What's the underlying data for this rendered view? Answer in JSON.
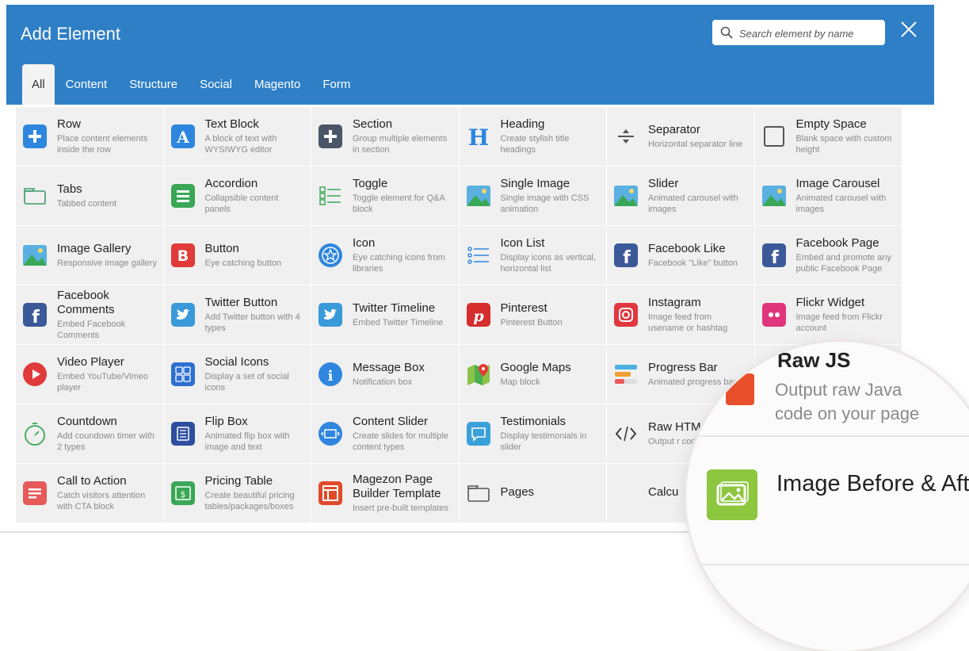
{
  "modal": {
    "title": "Add Element",
    "search": {
      "placeholder": "Search element by name"
    },
    "tabs": [
      {
        "label": "All",
        "active": true
      },
      {
        "label": "Content",
        "active": false
      },
      {
        "label": "Structure",
        "active": false
      },
      {
        "label": "Social",
        "active": false
      },
      {
        "label": "Magento",
        "active": false
      },
      {
        "label": "Form",
        "active": false
      }
    ]
  },
  "colors": {
    "header": "#2e7fc6",
    "cell_bg": "#f0f0f0"
  },
  "elements": [
    {
      "name": "Row",
      "desc": "Place content elements inside the row",
      "icon": "plus-icon",
      "color": "#2e86de"
    },
    {
      "name": "Text Block",
      "desc": "A block of text with WYSIWYG editor",
      "icon": "text-block-icon",
      "color": "#2e86de"
    },
    {
      "name": "Section",
      "desc": "Group multiple elements in section",
      "icon": "plus-icon",
      "color": "#4a5568"
    },
    {
      "name": "Heading",
      "desc": "Create stylish title headings",
      "icon": "heading-icon",
      "color": "#2e86de"
    },
    {
      "name": "Separator",
      "desc": "Horizontal separator line",
      "icon": "separator-icon",
      "color": "#555555"
    },
    {
      "name": "Empty Space",
      "desc": "Blank space with custom height",
      "icon": "empty-space-icon",
      "color": "#555555"
    },
    {
      "name": "Tabs",
      "desc": "Tabbed content",
      "icon": "tabs-icon",
      "color": "#3a9a6a"
    },
    {
      "name": "Accordion",
      "desc": "Collapsible content panels",
      "icon": "accordion-icon",
      "color": "#3aa757"
    },
    {
      "name": "Toggle",
      "desc": "Toggle element for Q&A block",
      "icon": "toggle-icon",
      "color": "#3aa757"
    },
    {
      "name": "Single Image",
      "desc": "Single image with CSS animation",
      "icon": "image-icon",
      "color": "#4ab0e0"
    },
    {
      "name": "Slider",
      "desc": "Animated carousel with images",
      "icon": "slider-icon",
      "color": "#4ab0e0"
    },
    {
      "name": "Image Carousel",
      "desc": "Animated carousel with images",
      "icon": "carousel-icon",
      "color": "#4ab0e0"
    },
    {
      "name": "Image Gallery",
      "desc": "Responsive image gallery",
      "icon": "gallery-icon",
      "color": "#4ab0e0"
    },
    {
      "name": "Button",
      "desc": "Eye catching button",
      "icon": "button-icon",
      "color": "#e03a3a"
    },
    {
      "name": "Icon",
      "desc": "Eye catching icons from libraries",
      "icon": "star-icon",
      "color": "#2e86de"
    },
    {
      "name": "Icon List",
      "desc": "Display icons as vertical, horizontal list",
      "icon": "icon-list-icon",
      "color": "#2e86de"
    },
    {
      "name": "Facebook Like",
      "desc": "Facebook \"Like\" button",
      "icon": "facebook-icon",
      "color": "#3b5998"
    },
    {
      "name": "Facebook Page",
      "desc": "Embed and promote any public Facebook Page",
      "icon": "facebook-icon",
      "color": "#3b5998"
    },
    {
      "name": "Facebook Comments",
      "desc": "Embed Facebook Comments",
      "icon": "facebook-icon",
      "color": "#3b5998"
    },
    {
      "name": "Twitter Button",
      "desc": "Add Twitter button with 4 types",
      "icon": "twitter-icon",
      "color": "#3a9ad9"
    },
    {
      "name": "Twitter Timeline",
      "desc": "Embed Twitter Timeline",
      "icon": "twitter-icon",
      "color": "#3a9ad9"
    },
    {
      "name": "Pinterest",
      "desc": "Pinterest Button",
      "icon": "pinterest-icon",
      "color": "#d62d2d"
    },
    {
      "name": "Instagram",
      "desc": "Image feed from usename or hashtag",
      "icon": "instagram-icon",
      "color": "#e0383e"
    },
    {
      "name": "Flickr Widget",
      "desc": "Image feed from Flickr account",
      "icon": "flickr-icon",
      "color": "#e0357a"
    },
    {
      "name": "Video Player",
      "desc": "Embed YouTube/Vimeo player",
      "icon": "play-icon",
      "color": "#e03a3a"
    },
    {
      "name": "Social Icons",
      "desc": "Display a set of social icons",
      "icon": "social-icons-icon",
      "color": "#2e6fd0"
    },
    {
      "name": "Message Box",
      "desc": "Notification box",
      "icon": "info-icon",
      "color": "#2e86de"
    },
    {
      "name": "Google Maps",
      "desc": "Map block",
      "icon": "map-icon",
      "color": "#34a853"
    },
    {
      "name": "Progress Bar",
      "desc": "Animated progress bar",
      "icon": "progress-icon",
      "color": "#f0a030"
    },
    {
      "name": "",
      "desc": "",
      "icon": "",
      "color": "#f0f0f0"
    },
    {
      "name": "Countdown",
      "desc": "Add coundown timer with 2 types",
      "icon": "timer-icon",
      "color": "#3aa757"
    },
    {
      "name": "Flip Box",
      "desc": "Animated flip box with image and text",
      "icon": "flip-box-icon",
      "color": "#2e4fa0"
    },
    {
      "name": "Content Slider",
      "desc": "Create slides for multiple content types",
      "icon": "content-slider-icon",
      "color": "#2e86de"
    },
    {
      "name": "Testimonials",
      "desc": "Display testimonials in slider",
      "icon": "chat-icon",
      "color": "#3aa0d9"
    },
    {
      "name": "Raw HTM",
      "desc": "Output r code on",
      "icon": "code-icon",
      "color": "#333333"
    },
    {
      "name": "",
      "desc": "",
      "icon": "",
      "color": "#f0f0f0"
    },
    {
      "name": "Call to Action",
      "desc": "Catch visitors attention with CTA block",
      "icon": "cta-icon",
      "color": "#e85a5a"
    },
    {
      "name": "Pricing Table",
      "desc": "Create beautiful pricing tables/packages/boxes",
      "icon": "pricing-icon",
      "color": "#3aa757"
    },
    {
      "name": "Magezon Page Builder Template",
      "desc": "Insert pre-built templates",
      "icon": "template-icon",
      "color": "#e04a2a"
    },
    {
      "name": "Pages",
      "desc": "",
      "icon": "pages-icon",
      "color": "#2e86de"
    },
    {
      "name": "Calcu",
      "desc": "",
      "icon": "",
      "color": "#f0f0f0"
    },
    {
      "name": "",
      "desc": "",
      "icon": "",
      "color": "#f0f0f0"
    }
  ],
  "magnifier": {
    "top_fragment": "Raw JS",
    "raw_js_desc_1": "Output raw Java",
    "raw_js_desc_2": "code on your page",
    "item_name": "Image Before & After",
    "item_icon": "image-before-after-icon",
    "item_color": "#8dc63f",
    "raw_icon_color": "#e8502b"
  }
}
